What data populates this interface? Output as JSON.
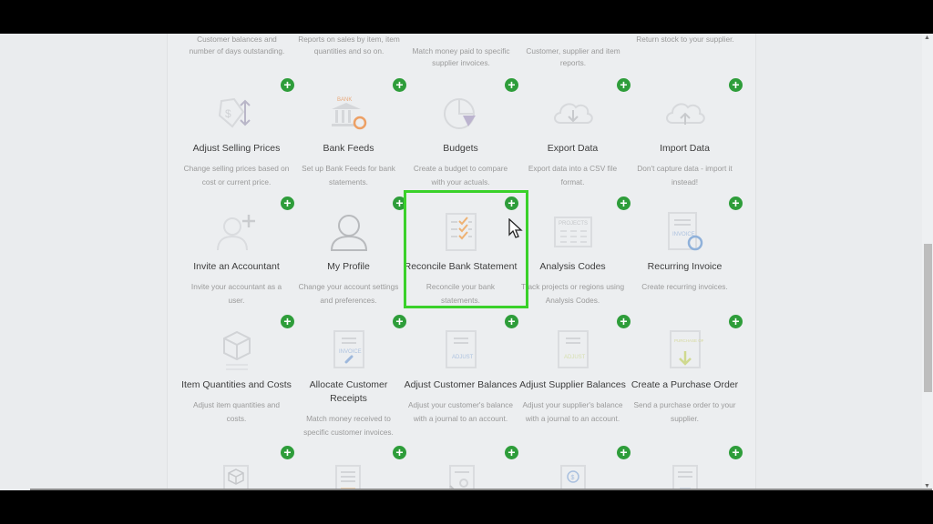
{
  "top_row_descriptions": [
    {
      "lines": [
        "Customer balances and",
        "number of days outstanding."
      ]
    },
    {
      "lines": [
        "Reports on sales by item, item",
        "quantities and so on."
      ]
    },
    {
      "lines": [
        "Match money paid to specific",
        "supplier invoices."
      ]
    },
    {
      "lines": [
        "Customer, supplier and item",
        "reports."
      ]
    },
    {
      "lines": [
        "Return stock to your supplier."
      ]
    }
  ],
  "tiles": [
    {
      "title": "Adjust Selling Prices",
      "desc": [
        "Change selling prices based on",
        "cost or current price."
      ],
      "icon": "price-tag-icon"
    },
    {
      "title": "Bank Feeds",
      "desc": [
        "Set up Bank Feeds for bank",
        "statements."
      ],
      "icon": "bank-icon",
      "icon_text": "BANK"
    },
    {
      "title": "Budgets",
      "desc": [
        "Create a budget to compare",
        "with your actuals."
      ],
      "icon": "pie-chart-icon"
    },
    {
      "title": "Export Data",
      "desc": [
        "Export data into a CSV file",
        "format."
      ],
      "icon": "cloud-download-icon"
    },
    {
      "title": "Import Data",
      "desc": [
        "Don't capture data - import it",
        "instead!"
      ],
      "icon": "cloud-upload-icon"
    },
    {
      "title": "Invite an Accountant",
      "desc": [
        "Invite your accountant as a",
        "user."
      ],
      "icon": "add-user-icon"
    },
    {
      "title": "My Profile",
      "desc": [
        "Change your account settings",
        "and preferences."
      ],
      "icon": "user-icon"
    },
    {
      "title": "Reconcile Bank Statement",
      "desc": [
        "Reconcile your bank",
        "statements."
      ],
      "icon": "checklist-icon"
    },
    {
      "title": "Analysis Codes",
      "desc": [
        "Track projects or regions using",
        "Analysis Codes."
      ],
      "icon": "projects-icon",
      "icon_text": "PROJECTS"
    },
    {
      "title": "Recurring Invoice",
      "desc": [
        "Create recurring invoices."
      ],
      "icon": "recurring-invoice-icon",
      "icon_text": "INVOICE"
    },
    {
      "title": "Item Quantities and Costs",
      "desc": [
        "Adjust item quantities and",
        "costs."
      ],
      "icon": "box-icon"
    },
    {
      "title": "Allocate Customer Receipts",
      "title_lines": [
        "Allocate Customer",
        "Receipts"
      ],
      "desc": [
        "Match money received to",
        "specific customer invoices."
      ],
      "icon": "invoice-link-icon",
      "icon_text": "INVOICE"
    },
    {
      "title": "Adjust Customer Balances",
      "desc": [
        "Adjust your customer's balance",
        "with a journal to an account."
      ],
      "icon": "adjust-customer-icon",
      "icon_text": "ADJUST"
    },
    {
      "title": "Adjust Supplier Balances",
      "desc": [
        "Adjust your supplier's balance",
        "with a journal to an account."
      ],
      "icon": "adjust-supplier-icon",
      "icon_text": "ADJUST"
    },
    {
      "title": "Create a Purchase Order",
      "desc": [
        "Send a purchase order to your",
        "supplier."
      ],
      "icon": "purchase-order-icon",
      "icon_text": "PURCHASE ORDER"
    }
  ],
  "bottom_row_icons": [
    "box-document-icon",
    "chart-of-accounts-icon",
    "transfer-user-icon",
    "dollar-document-icon",
    "sales-order-icon"
  ],
  "add_label": "+",
  "highlighted_tile": "Reconcile Bank Statement",
  "colors": {
    "add_button": "#2e9d3a",
    "highlight": "#3ad12a"
  }
}
